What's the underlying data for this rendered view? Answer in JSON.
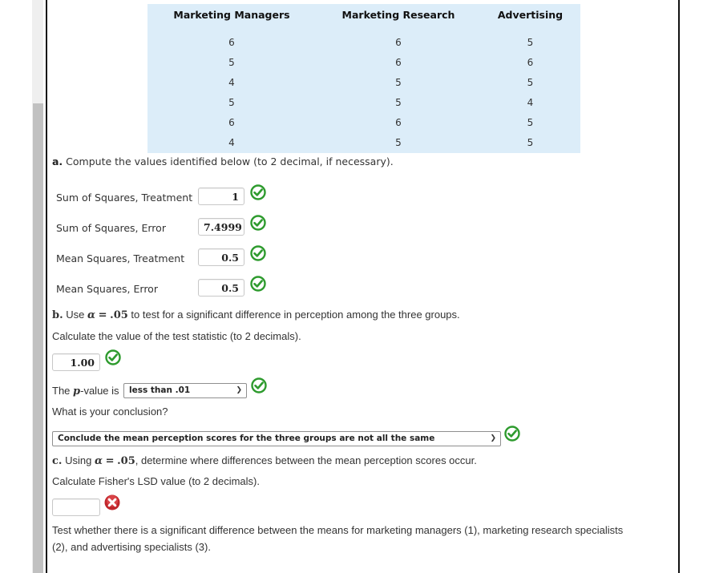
{
  "table": {
    "headers": [
      "Marketing Managers",
      "Marketing Research",
      "Advertising"
    ],
    "columns": [
      [
        "6",
        "5",
        "4",
        "5",
        "6",
        "4"
      ],
      [
        "6",
        "6",
        "5",
        "5",
        "6",
        "5"
      ],
      [
        "5",
        "6",
        "5",
        "4",
        "5",
        "5"
      ]
    ]
  },
  "part_a": {
    "prefix": "a.",
    "instruction": "Compute the values identified below (to 2 decimal, if necessary).",
    "rows": [
      {
        "label": "Sum of Squares, Treatment",
        "value": "1",
        "status": "correct"
      },
      {
        "label": "Sum of Squares, Error",
        "value": "7.4999",
        "status": "correct"
      },
      {
        "label": "Mean Squares, Treatment",
        "value": "0.5",
        "status": "correct"
      },
      {
        "label": "Mean Squares, Error",
        "value": "0.5",
        "status": "correct"
      }
    ]
  },
  "part_b": {
    "prefix": "b.",
    "use": "Use",
    "alpha_symbol": "α",
    "equals": "=",
    "alpha_value": ".05",
    "instruction_rest": "to test for a significant difference in perception among the three groups.",
    "test_stat_prompt": "Calculate the value of the test statistic (to 2 decimals).",
    "test_stat_value": "1.00",
    "test_stat_status": "correct",
    "pvalue_prefix": "The",
    "pvalue_symbol": "p",
    "pvalue_suffix": "-value is",
    "pvalue_selected": "less than .01",
    "pvalue_status": "correct",
    "conclusion_prompt": "What is your conclusion?",
    "conclusion_selected": "Conclude the mean perception scores for the three groups are not all the same",
    "conclusion_status": "correct"
  },
  "part_c": {
    "prefix": "c.",
    "using": "Using",
    "alpha_symbol": "α",
    "equals": "=",
    "alpha_value": ".05",
    "instruction_rest": ", determine where differences between the mean perception scores occur.",
    "lsd_prompt": "Calculate Fisher's LSD value (to 2 decimals).",
    "lsd_value": "",
    "lsd_status": "incorrect",
    "test_text_line1": "Test whether there is a significant difference between the means for marketing managers (1), marketing research specialists",
    "test_text_line2": "(2), and advertising specialists (3)."
  },
  "colors": {
    "table_bg": "#dcedf9",
    "correct": "#2e9b2e",
    "incorrect": "#c0262b"
  }
}
